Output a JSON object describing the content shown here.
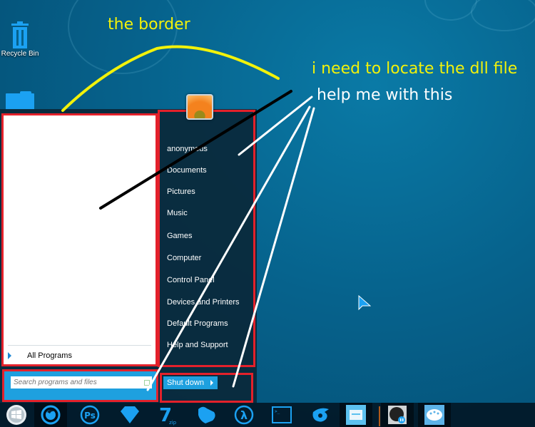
{
  "desktop": {
    "icons": [
      {
        "label": "Recycle Bin",
        "icon": "recycle-bin-icon"
      },
      {
        "label": "",
        "icon": "folder-icon"
      }
    ]
  },
  "annotations": {
    "border_note": "the border",
    "dll_note": "i need to locate the dll file",
    "help_note": "help me with this",
    "colors": {
      "yellow": "#f2f20a",
      "white": "#ffffff",
      "black": "#000000",
      "red_box": "#e3212b"
    }
  },
  "start_menu": {
    "all_programs_label": "All Programs",
    "search_placeholder": "Search programs and files",
    "search_value": "",
    "shutdown_label": "Shut down",
    "right_items": [
      {
        "label": "anonymous"
      },
      {
        "label": "Documents"
      },
      {
        "label": "Pictures"
      },
      {
        "label": "Music"
      },
      {
        "label": "Games"
      },
      {
        "label": "Computer"
      },
      {
        "label": "Control Panel"
      },
      {
        "label": "Devices and Printers"
      },
      {
        "label": "Default Programs"
      },
      {
        "label": "Help and Support"
      }
    ],
    "accent_color": "#1ea0df"
  },
  "taskbar": {
    "items": [
      {
        "name": "start-button",
        "icon": "windows-logo-icon"
      },
      {
        "name": "firefox",
        "icon": "firefox-icon",
        "active": true
      },
      {
        "name": "photoshop",
        "icon": "photoshop-icon",
        "label": "Ps"
      },
      {
        "name": "sketch",
        "icon": "diamond-icon"
      },
      {
        "name": "7zip",
        "icon": "7zip-icon",
        "label": "7",
        "sublabel": "zip"
      },
      {
        "name": "game-controller",
        "icon": "gamepad-icon"
      },
      {
        "name": "half-life",
        "icon": "half-life-icon",
        "label": "λ"
      },
      {
        "name": "command-prompt",
        "icon": "terminal-icon",
        "label": ">_"
      },
      {
        "name": "garena",
        "icon": "garena-icon"
      },
      {
        "name": "file-explorer",
        "icon": "folder-icon",
        "active": true
      },
      {
        "name": "itunes",
        "icon": "itunes-icon",
        "active": true
      },
      {
        "name": "paint",
        "icon": "palette-icon",
        "active": true
      }
    ]
  }
}
